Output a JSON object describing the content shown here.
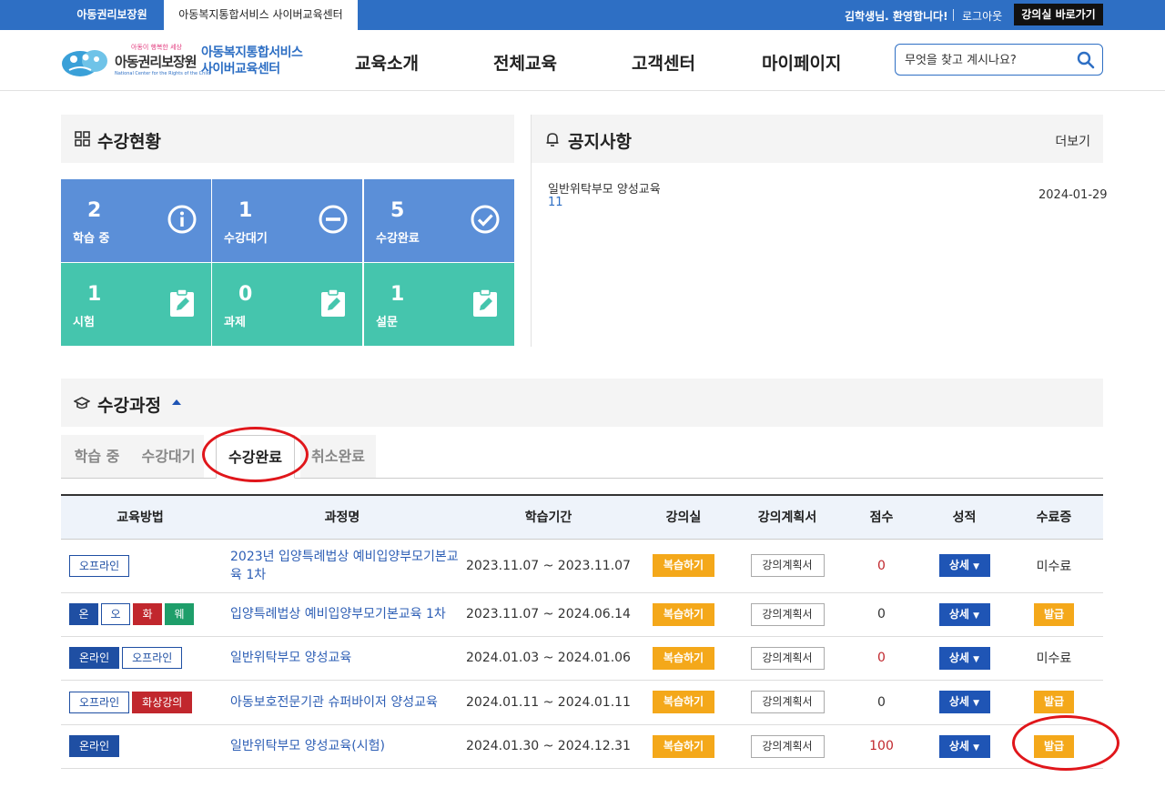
{
  "topbar": {
    "tab1": "아동권리보장원",
    "tab2": "아동복지통합서비스 사이버교육센터",
    "greeting": "김학생님. 환영합니다!",
    "logout": "로그아웃",
    "go_classroom": "강의실 바로가기"
  },
  "header": {
    "logo_small": "아동이 행복한 세상",
    "logo_org": "아동권리보장원",
    "logo_en": "National Center for the Rights of the Child",
    "logo_service_line1": "아동복지통합서비스",
    "logo_service_line2": "사이버교육센터",
    "nav": [
      "교육소개",
      "전체교육",
      "고객센터",
      "마이페이지"
    ],
    "search_placeholder": "무엇을 찾고 계시나요?"
  },
  "status": {
    "title": "수강현황",
    "tiles": [
      {
        "num": "2",
        "label": "학습 중",
        "icon": "info-icon"
      },
      {
        "num": "1",
        "label": "수강대기",
        "icon": "minus-circle-icon"
      },
      {
        "num": "5",
        "label": "수강완료",
        "icon": "check-circle-icon"
      },
      {
        "num": "1",
        "label": "시험",
        "icon": "clipboard-edit-icon"
      },
      {
        "num": "0",
        "label": "과제",
        "icon": "clipboard-edit-icon"
      },
      {
        "num": "1",
        "label": "설문",
        "icon": "clipboard-edit-icon"
      }
    ],
    "colors": {
      "blue": "#5b8fd8",
      "green": "#45c5ad"
    }
  },
  "notice": {
    "title": "공지사항",
    "more": "더보기",
    "items": [
      {
        "title": "일반위탁부모 양성교육",
        "count": "11",
        "date": "2024-01-29"
      }
    ]
  },
  "courses": {
    "title": "수강과정",
    "tabs": [
      "학습 중",
      "수강대기",
      "수강완료",
      "취소완료"
    ],
    "active_tab": "수강완료",
    "columns": [
      "교육방법",
      "과정명",
      "학습기간",
      "강의실",
      "강의계획서",
      "점수",
      "성적",
      "수료증"
    ],
    "review_label": "복습하기",
    "plan_label": "강의계획서",
    "detail_label": "상세",
    "rows": [
      {
        "methods": [
          {
            "t": "오프라인",
            "s": "off"
          }
        ],
        "name": "2023년 입양특례법상 예비입양부모기본교육 1차",
        "period": "2023.11.07 ~ 2023.11.07",
        "score": "0",
        "cert": "미수료"
      },
      {
        "methods": [
          {
            "t": "온",
            "s": "on"
          },
          {
            "t": "오",
            "s": "off"
          },
          {
            "t": "화",
            "s": "red"
          },
          {
            "t": "웨",
            "s": "grn"
          }
        ],
        "name": "입양특례법상 예비입양부모기본교육 1차",
        "period": "2023.11.07 ~ 2024.06.14",
        "score": "0",
        "cert": "발급"
      },
      {
        "methods": [
          {
            "t": "온라인",
            "s": "on"
          },
          {
            "t": "오프라인",
            "s": "off"
          }
        ],
        "name": "일반위탁부모 양성교육",
        "period": "2024.01.03 ~ 2024.01.06",
        "score": "0",
        "cert": "미수료"
      },
      {
        "methods": [
          {
            "t": "오프라인",
            "s": "off"
          },
          {
            "t": "화상강의",
            "s": "red"
          }
        ],
        "name": "아동보호전문기관 슈퍼바이저 양성교육",
        "period": "2024.01.11 ~ 2024.01.11",
        "score": "0",
        "cert": "발급"
      },
      {
        "methods": [
          {
            "t": "온라인",
            "s": "on"
          }
        ],
        "name": "일반위탁부모 양성교육(시험)",
        "period": "2024.01.30 ~ 2024.12.31",
        "score": "100",
        "cert": "발급"
      }
    ]
  }
}
